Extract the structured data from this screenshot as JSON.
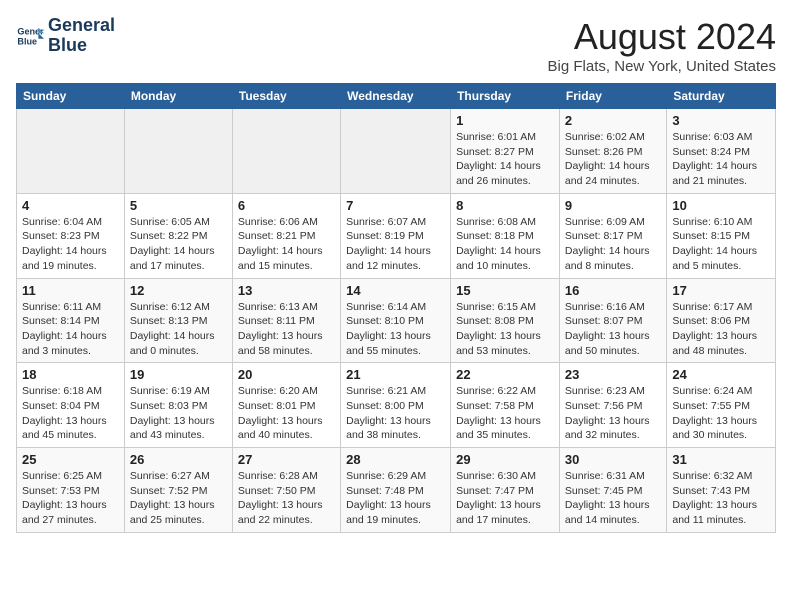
{
  "header": {
    "logo_line1": "General",
    "logo_line2": "Blue",
    "month": "August 2024",
    "location": "Big Flats, New York, United States"
  },
  "weekdays": [
    "Sunday",
    "Monday",
    "Tuesday",
    "Wednesday",
    "Thursday",
    "Friday",
    "Saturday"
  ],
  "weeks": [
    [
      {
        "day": "",
        "info": ""
      },
      {
        "day": "",
        "info": ""
      },
      {
        "day": "",
        "info": ""
      },
      {
        "day": "",
        "info": ""
      },
      {
        "day": "1",
        "info": "Sunrise: 6:01 AM\nSunset: 8:27 PM\nDaylight: 14 hours\nand 26 minutes."
      },
      {
        "day": "2",
        "info": "Sunrise: 6:02 AM\nSunset: 8:26 PM\nDaylight: 14 hours\nand 24 minutes."
      },
      {
        "day": "3",
        "info": "Sunrise: 6:03 AM\nSunset: 8:24 PM\nDaylight: 14 hours\nand 21 minutes."
      }
    ],
    [
      {
        "day": "4",
        "info": "Sunrise: 6:04 AM\nSunset: 8:23 PM\nDaylight: 14 hours\nand 19 minutes."
      },
      {
        "day": "5",
        "info": "Sunrise: 6:05 AM\nSunset: 8:22 PM\nDaylight: 14 hours\nand 17 minutes."
      },
      {
        "day": "6",
        "info": "Sunrise: 6:06 AM\nSunset: 8:21 PM\nDaylight: 14 hours\nand 15 minutes."
      },
      {
        "day": "7",
        "info": "Sunrise: 6:07 AM\nSunset: 8:19 PM\nDaylight: 14 hours\nand 12 minutes."
      },
      {
        "day": "8",
        "info": "Sunrise: 6:08 AM\nSunset: 8:18 PM\nDaylight: 14 hours\nand 10 minutes."
      },
      {
        "day": "9",
        "info": "Sunrise: 6:09 AM\nSunset: 8:17 PM\nDaylight: 14 hours\nand 8 minutes."
      },
      {
        "day": "10",
        "info": "Sunrise: 6:10 AM\nSunset: 8:15 PM\nDaylight: 14 hours\nand 5 minutes."
      }
    ],
    [
      {
        "day": "11",
        "info": "Sunrise: 6:11 AM\nSunset: 8:14 PM\nDaylight: 14 hours\nand 3 minutes."
      },
      {
        "day": "12",
        "info": "Sunrise: 6:12 AM\nSunset: 8:13 PM\nDaylight: 14 hours\nand 0 minutes."
      },
      {
        "day": "13",
        "info": "Sunrise: 6:13 AM\nSunset: 8:11 PM\nDaylight: 13 hours\nand 58 minutes."
      },
      {
        "day": "14",
        "info": "Sunrise: 6:14 AM\nSunset: 8:10 PM\nDaylight: 13 hours\nand 55 minutes."
      },
      {
        "day": "15",
        "info": "Sunrise: 6:15 AM\nSunset: 8:08 PM\nDaylight: 13 hours\nand 53 minutes."
      },
      {
        "day": "16",
        "info": "Sunrise: 6:16 AM\nSunset: 8:07 PM\nDaylight: 13 hours\nand 50 minutes."
      },
      {
        "day": "17",
        "info": "Sunrise: 6:17 AM\nSunset: 8:06 PM\nDaylight: 13 hours\nand 48 minutes."
      }
    ],
    [
      {
        "day": "18",
        "info": "Sunrise: 6:18 AM\nSunset: 8:04 PM\nDaylight: 13 hours\nand 45 minutes."
      },
      {
        "day": "19",
        "info": "Sunrise: 6:19 AM\nSunset: 8:03 PM\nDaylight: 13 hours\nand 43 minutes."
      },
      {
        "day": "20",
        "info": "Sunrise: 6:20 AM\nSunset: 8:01 PM\nDaylight: 13 hours\nand 40 minutes."
      },
      {
        "day": "21",
        "info": "Sunrise: 6:21 AM\nSunset: 8:00 PM\nDaylight: 13 hours\nand 38 minutes."
      },
      {
        "day": "22",
        "info": "Sunrise: 6:22 AM\nSunset: 7:58 PM\nDaylight: 13 hours\nand 35 minutes."
      },
      {
        "day": "23",
        "info": "Sunrise: 6:23 AM\nSunset: 7:56 PM\nDaylight: 13 hours\nand 32 minutes."
      },
      {
        "day": "24",
        "info": "Sunrise: 6:24 AM\nSunset: 7:55 PM\nDaylight: 13 hours\nand 30 minutes."
      }
    ],
    [
      {
        "day": "25",
        "info": "Sunrise: 6:25 AM\nSunset: 7:53 PM\nDaylight: 13 hours\nand 27 minutes."
      },
      {
        "day": "26",
        "info": "Sunrise: 6:27 AM\nSunset: 7:52 PM\nDaylight: 13 hours\nand 25 minutes."
      },
      {
        "day": "27",
        "info": "Sunrise: 6:28 AM\nSunset: 7:50 PM\nDaylight: 13 hours\nand 22 minutes."
      },
      {
        "day": "28",
        "info": "Sunrise: 6:29 AM\nSunset: 7:48 PM\nDaylight: 13 hours\nand 19 minutes."
      },
      {
        "day": "29",
        "info": "Sunrise: 6:30 AM\nSunset: 7:47 PM\nDaylight: 13 hours\nand 17 minutes."
      },
      {
        "day": "30",
        "info": "Sunrise: 6:31 AM\nSunset: 7:45 PM\nDaylight: 13 hours\nand 14 minutes."
      },
      {
        "day": "31",
        "info": "Sunrise: 6:32 AM\nSunset: 7:43 PM\nDaylight: 13 hours\nand 11 minutes."
      }
    ]
  ]
}
